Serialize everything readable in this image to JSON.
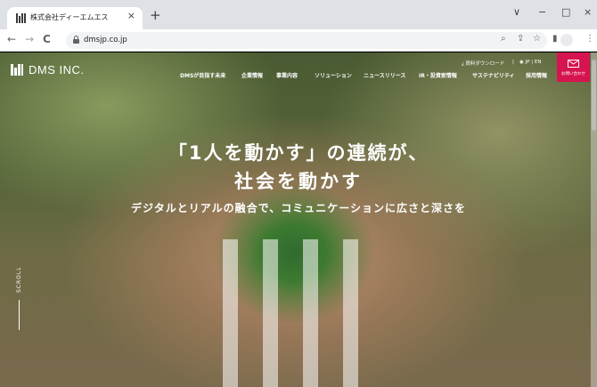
{
  "browser": {
    "tab_title": "株式会社ディーエムエス",
    "url": "dmsjp.co.jp",
    "new_tab": "+",
    "tab_close": "×",
    "win_minimize": "−",
    "win_maximize": "□",
    "win_close": "×",
    "win_chevron": "∨",
    "back": "←",
    "forward": "→",
    "reload": "C"
  },
  "header": {
    "logo_text": "DMS INC.",
    "util_download": "資料ダウンロード",
    "util_lang": "JP | EN",
    "nav": [
      "DMSが目指す未来",
      "企業情報",
      "事業内容",
      "ソリューション",
      "ニュースリリース",
      "IR・投資家情報",
      "サステナビリティ",
      "採用情報"
    ],
    "contact_label": "お問い合わせ"
  },
  "hero": {
    "line1": "「1人を動かす」の連続が、",
    "line2": "社会を動かす",
    "sub": "デジタルとリアルの融合で、コミュニケーションに広さと深さを"
  },
  "scroll_label": "SCROLL",
  "colors": {
    "accent": "#d6144f",
    "tabstrip": "#dee1e6"
  }
}
